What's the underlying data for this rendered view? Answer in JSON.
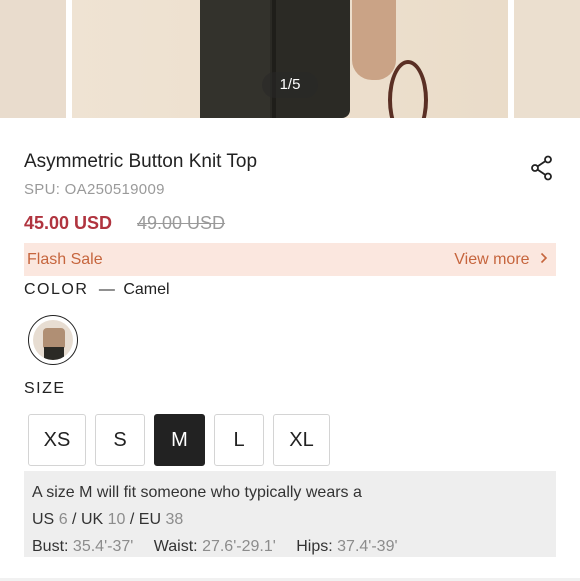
{
  "gallery": {
    "counter": "1/5"
  },
  "product": {
    "title": "Asymmetric Button Knit Top",
    "spu": "SPU: OA250519009",
    "price": "45.00 USD",
    "original_price": "49.00 USD"
  },
  "promo": {
    "label": "Flash Sale",
    "view_more": "View more",
    "accent_color": "#c6653d",
    "background_color": "#fbe7df"
  },
  "color": {
    "label": "COLOR",
    "separator": "—",
    "selected": "Camel"
  },
  "size": {
    "label": "SIZE",
    "options": [
      "XS",
      "S",
      "M",
      "L",
      "XL"
    ],
    "selected": "M"
  },
  "fit": {
    "intro": "A size M will fit someone who typically wears a",
    "us_label": "US",
    "us_value": "6",
    "uk_label": "UK",
    "uk_value": "10",
    "eu_label": "EU",
    "eu_value": "38",
    "sep": "/",
    "bust_label": "Bust:",
    "bust_value": "35.4'-37'",
    "waist_label": "Waist:",
    "waist_value": "27.6'-29.1'",
    "hips_label": "Hips:",
    "hips_value": "37.4'-39'"
  },
  "icons": {
    "share": "share-icon",
    "chevron": "chevron-right-icon"
  },
  "colors": {
    "price": "#b0343f",
    "muted": "#9a9a9a",
    "selected_size_bg": "#222222"
  }
}
